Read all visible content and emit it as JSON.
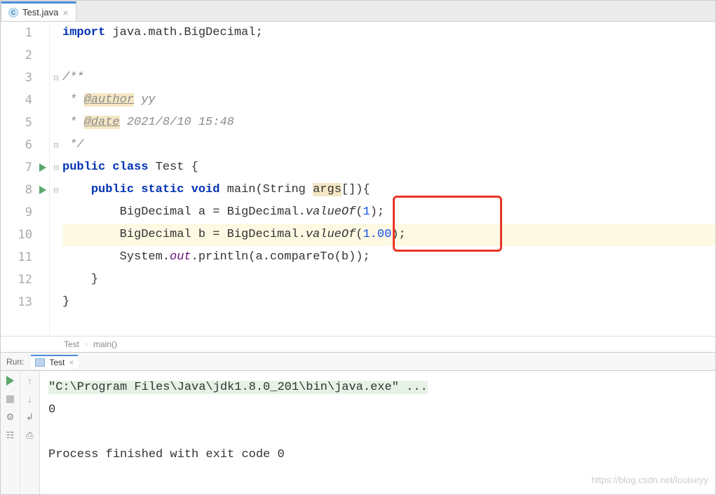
{
  "tab": {
    "filename": "Test.java"
  },
  "gutter": [
    "1",
    "2",
    "3",
    "4",
    "5",
    "6",
    "7",
    "8",
    "9",
    "10",
    "11",
    "12",
    "13",
    ""
  ],
  "run_icons_at": [
    7,
    8
  ],
  "code": {
    "l1": {
      "kw": "import",
      "rest": " java.math.BigDecimal;"
    },
    "l2": "",
    "l3": "/**",
    "l4_pre": " * ",
    "l4_tag": "@author",
    "l4_post": " yy",
    "l5_pre": " * ",
    "l5_tag": "@date",
    "l5_post": " 2021/8/10 15:48",
    "l6": " */",
    "l7": {
      "kw1": "public",
      "kw2": "class",
      "name": " Test {"
    },
    "l8": {
      "kw1": "public",
      "kw2": "static",
      "kw3": "void",
      "name": " main(String ",
      "args": "args",
      "post": "[]){"
    },
    "l9": {
      "pre": "        BigDecimal a = BigDecimal.",
      "method": "valueOf",
      "open": "(",
      "num": "1",
      "close": ");"
    },
    "l10": {
      "pre": "        BigDecimal b = BigDecimal.",
      "method": "valueOf",
      "open": "(",
      "num": "1.00",
      "close": ");"
    },
    "l11": {
      "pre": "        System.",
      "field": "out",
      "post": ".println(a.compareTo(b));"
    },
    "l12": "    }",
    "l13": "}"
  },
  "breadcrumb": {
    "a": "Test",
    "b": "main()"
  },
  "run": {
    "label": "Run:",
    "tab_name": "Test",
    "command": "\"C:\\Program Files\\Java\\jdk1.8.0_201\\bin\\java.exe\" ...",
    "output": "0",
    "exit": "Process finished with exit code 0"
  },
  "watermark": "https://blog.csdn.net/louiseyy"
}
